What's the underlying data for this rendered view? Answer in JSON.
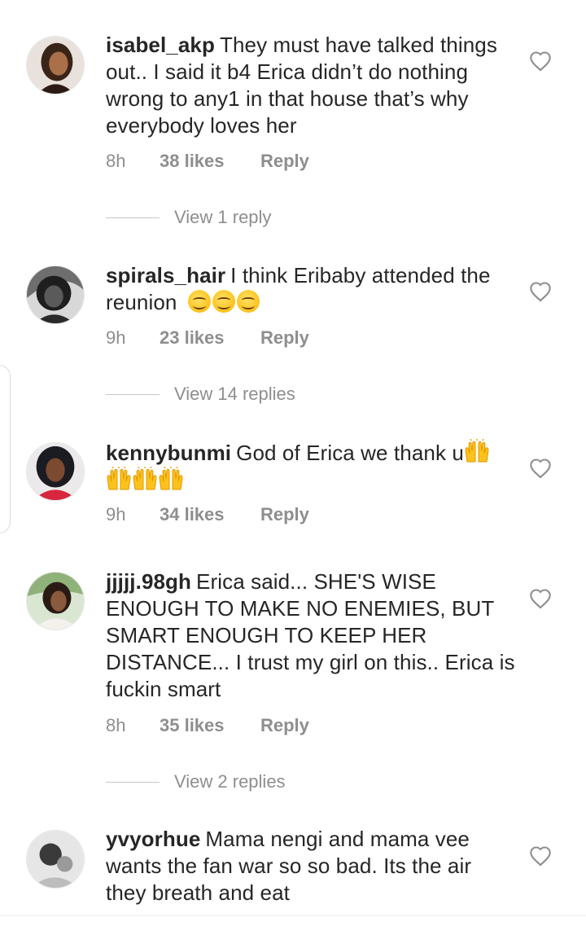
{
  "comments": [
    {
      "username": "isabel_akp",
      "text": "They must have talked things out.. I said it b4 Erica didn’t do nothing wrong to any1 in that house that’s why everybody loves her",
      "time": "8h",
      "likes": "38 likes",
      "reply": "Reply",
      "view_replies": "View 1 reply"
    },
    {
      "username": "spirals_hair",
      "text": "I think Eribaby attended the reunion",
      "emoji": "smiling-face-emoji x3",
      "time": "9h",
      "likes": "23 likes",
      "reply": "Reply",
      "view_replies": "View 14 replies"
    },
    {
      "username": "kennybunmi",
      "text": "God of Erica we thank u",
      "emoji": "raising-hands-emoji x4",
      "time": "9h",
      "likes": "34 likes",
      "reply": "Reply"
    },
    {
      "username": "jjjjj.98gh",
      "text": "Erica said... SHE'S WISE ENOUGH TO MAKE NO ENEMIES, BUT SMART ENOUGH TO KEEP HER DISTANCE... I trust my girl on this.. Erica is fuckin smart",
      "time": "8h",
      "likes": "35 likes",
      "reply": "Reply",
      "view_replies": "View 2 replies"
    },
    {
      "username": "yvyorhue",
      "text": "Mama nengi and mama vee wants the fan war so so bad. Its the air they breath and eat"
    }
  ],
  "icons": {
    "like": "heart-outline-icon",
    "avatar": "user-avatar"
  },
  "colors": {
    "text": "#262626",
    "meta": "#8e8e8e",
    "divider": "#c7c7c7"
  }
}
